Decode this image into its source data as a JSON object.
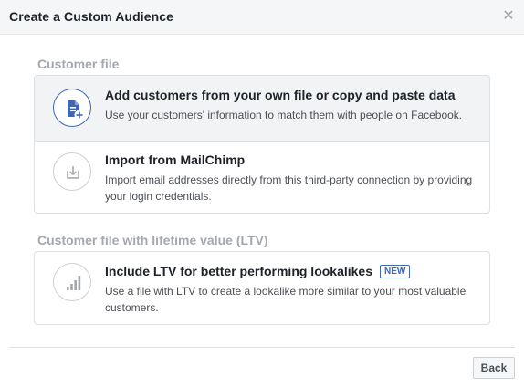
{
  "dialog": {
    "title": "Create a Custom Audience",
    "close_icon": "close-icon"
  },
  "sections": [
    {
      "title": "Customer file",
      "options": [
        {
          "icon": "customer-file-upload-icon",
          "title": "Add customers from your own file or copy and paste data",
          "description": "Use your customers' information to match them with people on Facebook.",
          "selected": true
        },
        {
          "icon": "import-download-icon",
          "title": "Import from MailChimp",
          "description": "Import email addresses directly from this third-party connection by providing your login credentials.",
          "selected": false
        }
      ]
    },
    {
      "title": "Customer file with lifetime value (LTV)",
      "options": [
        {
          "icon": "bar-chart-icon",
          "title": "Include LTV for better performing lookalikes",
          "badge": "NEW",
          "description": "Use a file with LTV to create a lookalike more similar to your most valuable customers.",
          "selected": false
        }
      ]
    }
  ],
  "footer": {
    "back_label": "Back"
  },
  "colors": {
    "accent": "#4267b2",
    "section_title": "#a4a8ae",
    "border": "#dddfe2",
    "selected_bg": "#f2f3f5"
  }
}
